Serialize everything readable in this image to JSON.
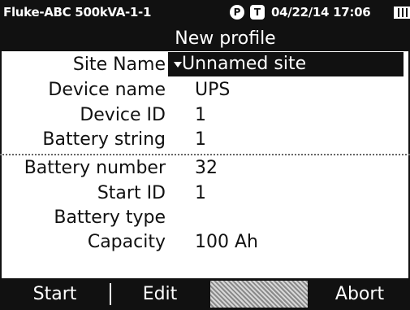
{
  "status_bar": {
    "device_name": "Fluke-ABC 500kVA-1-1",
    "indicator_p": "P",
    "indicator_t": "T",
    "datetime": "04/22/14 17:06",
    "battery_icon": "battery-icon"
  },
  "title": "New profile",
  "form": {
    "site_name": {
      "label": "Site Name",
      "value": "Unnamed site",
      "icon": "dropdown-caret-icon"
    },
    "device_name": {
      "label": "Device name",
      "value": "UPS"
    },
    "device_id": {
      "label": "Device ID",
      "value": "1"
    },
    "battery_string": {
      "label": "Battery string",
      "value": "1"
    },
    "battery_number": {
      "label": "Battery number",
      "value": "32"
    },
    "start_id": {
      "label": "Start ID",
      "value": "1"
    },
    "battery_type": {
      "label": "Battery type",
      "value": ""
    },
    "capacity": {
      "label": "Capacity",
      "value": "100 Ah"
    }
  },
  "softkeys": {
    "f1": "Start",
    "f2": "Edit",
    "f3": "",
    "f4": "Abort"
  },
  "colors": {
    "foreground": "#111111",
    "background": "#ffffff"
  }
}
